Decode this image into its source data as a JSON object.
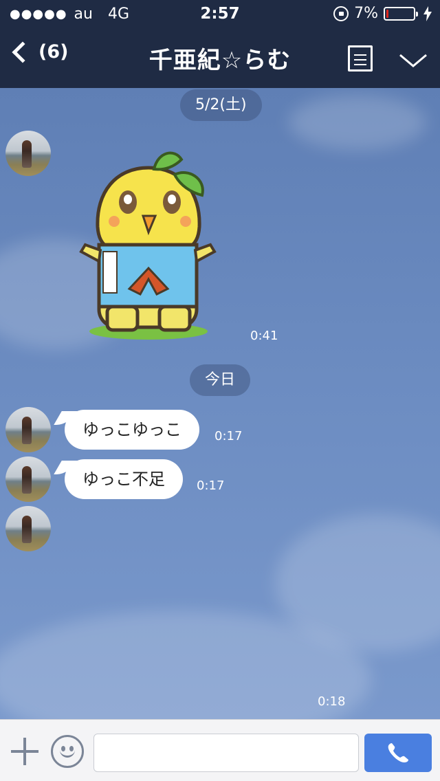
{
  "status_bar": {
    "carrier": "au",
    "network": "4G",
    "time": "2:57",
    "battery_percent": "7%",
    "battery_level": 0.07,
    "signal_dots": "●●●●●"
  },
  "nav": {
    "unread_count": "(6)",
    "title": "千亜紀☆らむ"
  },
  "chat": {
    "date_divider_1": "5/2(土)",
    "sticker_time": "0:41",
    "date_divider_2": "今日",
    "messages": [
      {
        "text": "ゆっこゆっこ",
        "time": "0:17"
      },
      {
        "text": "ゆっこ不足",
        "time": "0:17"
      }
    ],
    "last_time": "0:18"
  },
  "input": {
    "placeholder": "",
    "value": ""
  },
  "colors": {
    "header_bg": "#1f2b44",
    "chat_bg": "#6b8bbf",
    "call_button": "#4a7fe0",
    "battery_low": "#e0261f"
  },
  "icons": [
    "back-chevron-icon",
    "menu-list-icon",
    "chevron-down-icon",
    "plus-icon",
    "emoji-icon",
    "phone-icon",
    "rotation-lock-icon",
    "charging-bolt-icon"
  ]
}
